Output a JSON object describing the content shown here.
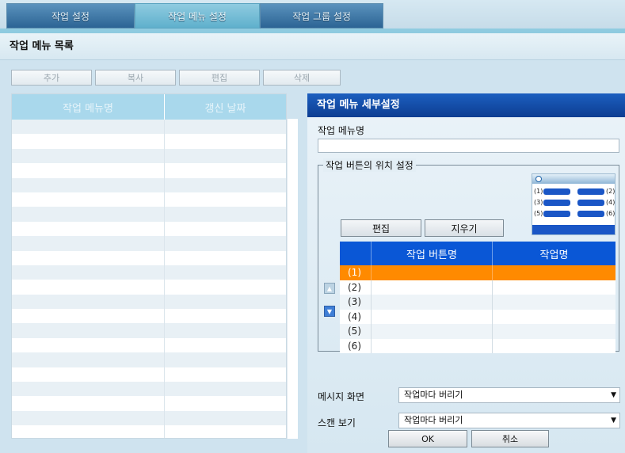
{
  "tabs": [
    "작업 설정",
    "작업 메뉴 설정",
    "작업 그룹 설정"
  ],
  "list_title": "작업 메뉴 목록",
  "toolbar": {
    "add": "추가",
    "copy": "복사",
    "edit": "편집",
    "delete": "삭제"
  },
  "menu_list": {
    "col_name": "작업 메뉴명",
    "col_date": "갱신 날짜"
  },
  "detail": {
    "title": "작업 메뉴 세부설정",
    "name_label": "작업 메뉴명",
    "name_value": "",
    "group_title": "작업 버튼의 위치 설정",
    "edit_button": "편집",
    "clear_button": "지우기",
    "table": {
      "col_button": "작업 버튼명",
      "col_job": "작업명",
      "rows": [
        "(1)",
        "(2)",
        "(3)",
        "(4)",
        "(5)",
        "(6)"
      ],
      "selected_index": 0
    },
    "preview_labels": [
      "(1)",
      "(2)",
      "(3)",
      "(4)",
      "(5)",
      "(6)"
    ],
    "message_label": "메시지 화면",
    "message_value": "작업마다 버리기",
    "scan_label": "스캔 보기",
    "scan_value": "작업마다 버리기",
    "ok": "OK",
    "cancel": "취소"
  },
  "colors": {
    "accent": "#0a57d6",
    "selected_row": "#ff8a00"
  }
}
